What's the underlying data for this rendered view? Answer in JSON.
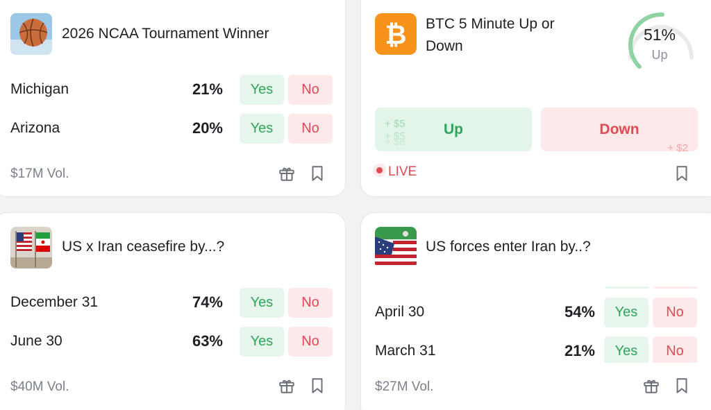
{
  "colors": {
    "yes_bg": "#e6f6ec",
    "yes_text": "#2fa55a",
    "no_bg": "#fde9ea",
    "no_text": "#e14a52",
    "btc_orange": "#f7931a",
    "gauge_green": "#8fd3a4"
  },
  "cards": [
    {
      "title": "2026 NCAA Tournament Winner",
      "thumb_icon": "basketball-icon",
      "outcomes": [
        {
          "label": "Michigan",
          "pct": "21%",
          "yes": "Yes",
          "no": "No"
        },
        {
          "label": "Arizona",
          "pct": "20%",
          "yes": "Yes",
          "no": "No"
        }
      ],
      "volume": "$17M Vol.",
      "icons": [
        "gift-icon",
        "bookmark-icon"
      ]
    },
    {
      "title": "BTC 5 Minute Up or Down",
      "thumb_icon": "bitcoin-icon",
      "gauge": {
        "pct": "51%",
        "label": "Up",
        "value": 0.51
      },
      "up_label": "Up",
      "down_label": "Down",
      "up_floats": [
        "+ $5",
        "+ $5",
        "+ $8"
      ],
      "down_float": "+ $2",
      "live_label": "LIVE",
      "icons": [
        "bookmark-icon"
      ]
    },
    {
      "title": "US x Iran ceasefire by...?",
      "thumb_icon": "us-iran-flags-icon",
      "outcomes": [
        {
          "label": "December 31",
          "pct": "74%",
          "yes": "Yes",
          "no": "No"
        },
        {
          "label": "June 30",
          "pct": "63%",
          "yes": "Yes",
          "no": "No"
        }
      ],
      "volume": "$40M Vol.",
      "icons": [
        "gift-icon",
        "bookmark-icon"
      ]
    },
    {
      "title": "US forces enter Iran by..?",
      "thumb_icon": "us-iran-flag-blend-icon",
      "outcomes": [
        {
          "label": "April 30",
          "pct": "54%",
          "yes": "Yes",
          "no": "No"
        },
        {
          "label": "March 31",
          "pct": "21%",
          "yes": "Yes",
          "no": "No"
        }
      ],
      "volume": "$27M Vol.",
      "icons": [
        "gift-icon",
        "bookmark-icon"
      ]
    }
  ]
}
